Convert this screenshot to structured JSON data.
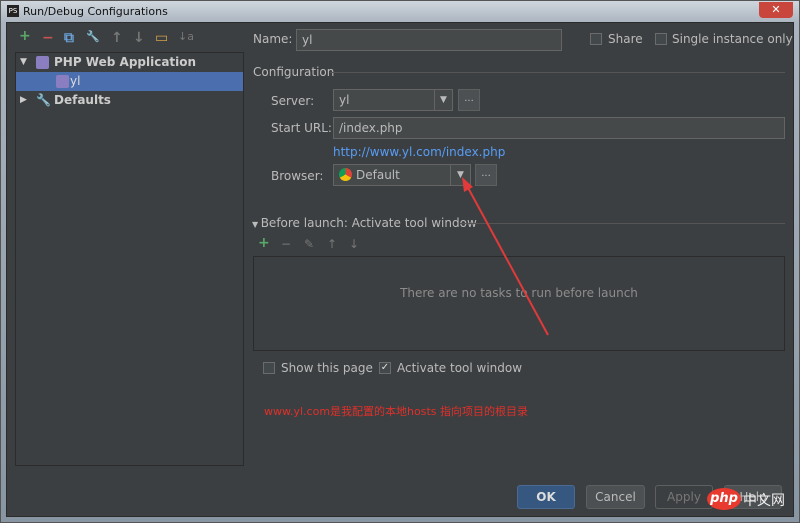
{
  "window": {
    "title": "Run/Debug Configurations",
    "close_icon": "✕"
  },
  "toolbar": {
    "add": "+",
    "remove": "−",
    "copy": "⧉",
    "edit_defaults": "🔧",
    "move_up": "↑",
    "move_down": "↓",
    "folder": "▭",
    "sort": "↓a"
  },
  "tree": {
    "items": [
      {
        "label": "PHP Web Application",
        "expanded": true
      },
      {
        "label": "yl",
        "selected": true
      },
      {
        "label": "Defaults",
        "expanded": false
      }
    ]
  },
  "form": {
    "name_label": "Name:",
    "name_value": "yl",
    "share_label": "Share",
    "single_instance_label": "Single instance only",
    "configuration_label": "Configuration",
    "server_label": "Server:",
    "server_value": "yl",
    "start_url_label": "Start URL:",
    "start_url_value": "/index.php",
    "url_link": "http://www.yl.com/index.php",
    "browser_label": "Browser:",
    "browser_value": "Default",
    "more": "..."
  },
  "before_launch": {
    "title": "Before launch: Activate tool window",
    "empty_text": "There are no tasks to run before launch",
    "show_page_label": "Show this page",
    "activate_label": "Activate tool window",
    "activate_checked": true,
    "show_checked": false
  },
  "annotation": "www.yl.com是我配置的本地hosts 指向项目的根目录",
  "buttons": {
    "ok": "OK",
    "cancel": "Cancel",
    "apply": "Apply",
    "help": "Help"
  },
  "watermark": "php中文网",
  "colors": {
    "bg": "#3c3f41",
    "selection": "#4b6eaf",
    "link": "#589df6",
    "annotation": "#e0302a",
    "arrow": "#e03a3a"
  }
}
